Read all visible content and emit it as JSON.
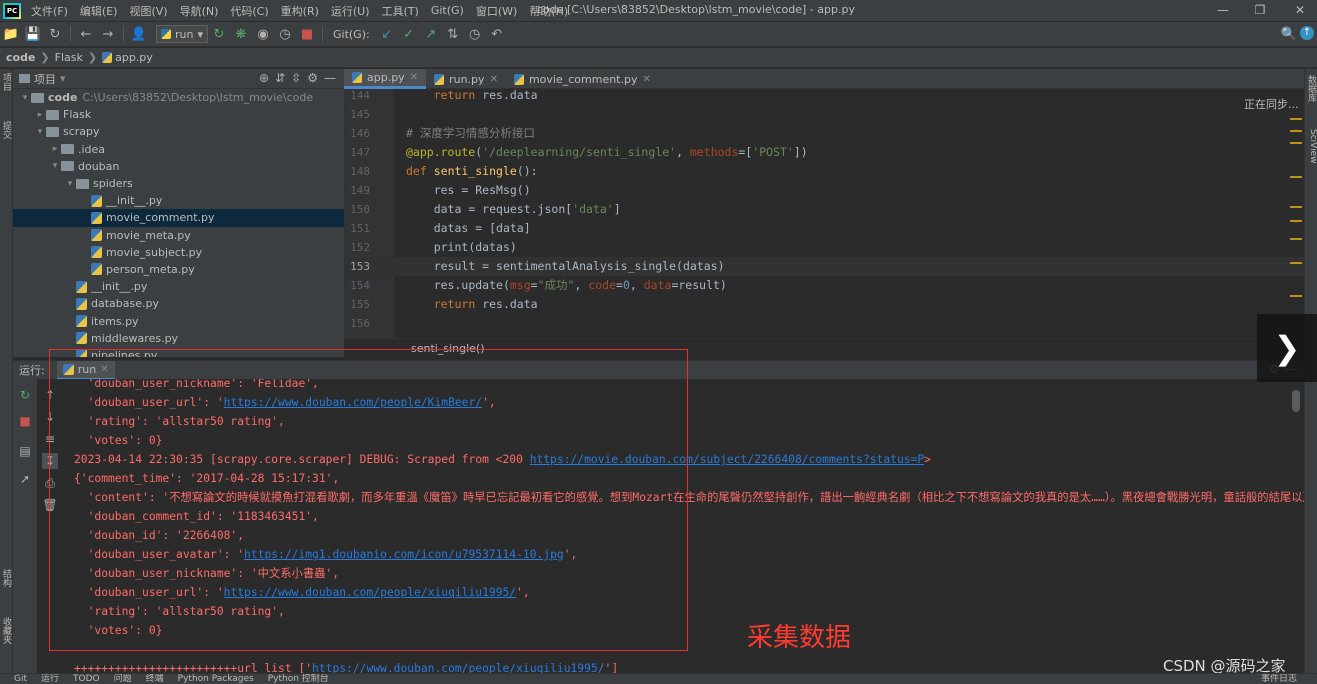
{
  "menubar": {
    "items": [
      "文件(F)",
      "编辑(E)",
      "视图(V)",
      "导航(N)",
      "代码(C)",
      "重构(R)",
      "运行(U)",
      "工具(T)",
      "Git(G)",
      "窗口(W)",
      "帮助(H)"
    ],
    "window_title": "code [C:\\Users\\83852\\Desktop\\lstm_movie\\code] - app.py",
    "minimize_icon": "minimize-icon",
    "maximize_icon": "maximize-icon",
    "close_icon": "close-icon"
  },
  "toolbar": {
    "run_config": "run",
    "git_label": "Git(G):"
  },
  "breadcrumb": [
    "code",
    "Flask",
    "app.py"
  ],
  "left_strip": {
    "top1": "项目",
    "top2": "提交",
    "bottom1": "结构",
    "bottom2": "收藏夹"
  },
  "project": {
    "header": "项目",
    "tree": [
      {
        "label": "code",
        "path": "C:\\Users\\83852\\Desktop\\lstm_movie\\code",
        "type": "folder",
        "depth": 0,
        "open": true,
        "bold": true
      },
      {
        "label": "Flask",
        "type": "folder",
        "depth": 1,
        "open": false
      },
      {
        "label": "scrapy",
        "type": "folder",
        "depth": 1,
        "open": true
      },
      {
        "label": ".idea",
        "type": "folder",
        "depth": 2,
        "open": false
      },
      {
        "label": "douban",
        "type": "folder",
        "depth": 2,
        "open": true
      },
      {
        "label": "spiders",
        "type": "folder",
        "depth": 3,
        "open": true
      },
      {
        "label": "__init__.py",
        "type": "py",
        "depth": 4
      },
      {
        "label": "movie_comment.py",
        "type": "py",
        "depth": 4,
        "selected": true
      },
      {
        "label": "movie_meta.py",
        "type": "py",
        "depth": 4
      },
      {
        "label": "movie_subject.py",
        "type": "py",
        "depth": 4
      },
      {
        "label": "person_meta.py",
        "type": "py",
        "depth": 4
      },
      {
        "label": "__init__.py",
        "type": "py",
        "depth": 3
      },
      {
        "label": "database.py",
        "type": "py",
        "depth": 3
      },
      {
        "label": "items.py",
        "type": "py",
        "depth": 3
      },
      {
        "label": "middlewares.py",
        "type": "py",
        "depth": 3
      },
      {
        "label": "pipelines.py",
        "type": "py",
        "depth": 3
      }
    ]
  },
  "editor": {
    "tabs": [
      {
        "label": "app.py",
        "active": true
      },
      {
        "label": "run.py",
        "active": false
      },
      {
        "label": "movie_comment.py",
        "active": false
      }
    ],
    "lines": [
      {
        "n": "144",
        "html": "    <span class='kw'>return</span> <span class='plain'>res.data</span>"
      },
      {
        "n": "145",
        "html": ""
      },
      {
        "n": "146",
        "html": "<span class='cmt'># 深度学习情感分析接口</span>"
      },
      {
        "n": "147",
        "html": "<span class='dec'>@app.route</span><span class='plain'>(</span><span class='str'>'/deeplearning/senti_single'</span><span class='plain'>, </span><span class='param'>methods</span><span class='plain'>=[</span><span class='str'>'POST'</span><span class='plain'>])</span>"
      },
      {
        "n": "148",
        "html": "<span class='kw'>def</span> <span class='fn'>senti_single</span><span class='plain'>():</span>"
      },
      {
        "n": "149",
        "html": "    <span class='plain'>res = ResMsg()</span>"
      },
      {
        "n": "150",
        "html": "    <span class='plain'>data = request.json[</span><span class='str'>'data'</span><span class='plain'>]</span>"
      },
      {
        "n": "151",
        "html": "    <span class='plain'>datas = [data]</span>"
      },
      {
        "n": "152",
        "html": "    <span class='plain'>print(datas)</span>"
      },
      {
        "n": "153",
        "html": "    <span class='plain'>result = sentimentalAnalysis_single(datas)</span>",
        "current": true
      },
      {
        "n": "154",
        "html": "    <span class='plain'>res.update(</span><span class='param'>msg</span><span class='plain'>=</span><span class='str'>\"成功\"</span><span class='plain'>, </span><span class='param'>code</span><span class='plain'>=</span><span class='num'>0</span><span class='plain'>, </span><span class='param'>data</span><span class='plain'>=result)</span>"
      },
      {
        "n": "155",
        "html": "    <span class='kw'>return</span> <span class='plain'>res.data</span>"
      },
      {
        "n": "156",
        "html": ""
      }
    ],
    "crumb": "senti_single()",
    "sync_status": "正在同步..."
  },
  "right_strip": {
    "label1": "数据库",
    "label2": "SciView"
  },
  "run": {
    "panel_label": "运行:",
    "tab_label": "run",
    "console": [
      {
        "text": "  'douban_user_nickname': 'Felidae',"
      },
      {
        "pre": "  'douban_user_url': '",
        "link": "https://www.douban.com/people/KimBeer/",
        "post": "',"
      },
      {
        "text": "  'rating': 'allstar50 rating',"
      },
      {
        "text": "  'votes': 0}"
      },
      {
        "pre": "2023-04-14 22:30:35 [scrapy.core.scraper] DEBUG: Scraped from <200 ",
        "link": "https://movie.douban.com/subject/2266408/comments?status=P",
        "post": ">"
      },
      {
        "text": "{'comment_time': '2017-04-28 15:17:31',"
      },
      {
        "text": "  'content': '不想寫論文的時候就摸魚打混看歌劇，而多年重溫《魔笛》時早已忘記最初看它的感覺。想到Mozart在生命的尾聲仍然堅持創作，譜出一齣經典名劇（相比之下不想寫論文的我真的是太……）。黑夜總會戰勝光明，童話般的結尾以及滋"
      },
      {
        "text": "  'douban_comment_id': '1183463451',"
      },
      {
        "text": "  'douban_id': '2266408',"
      },
      {
        "pre": "  'douban_user_avatar': '",
        "link": "https://img1.doubanio.com/icon/u79537114-10.jpg",
        "post": "',"
      },
      {
        "text": "  'douban_user_nickname': '中文系小書蟲',"
      },
      {
        "pre": "  'douban_user_url': '",
        "link": "https://www.douban.com/people/xiuqiliu1995/",
        "post": "',"
      },
      {
        "text": "  'rating': 'allstar50 rating',"
      },
      {
        "text": "  'votes': 0}"
      },
      {
        "text": ""
      },
      {
        "pre": "++++++++++++++++++++++++url_list ['",
        "link": "https://www.douban.com/people/xiuqiliu1995/",
        "post": "']"
      }
    ]
  },
  "caption": "采集数据",
  "watermark": "CSDN @源码之家",
  "statusbar": {
    "items": [
      "Git",
      "运行",
      "TODO",
      "问题",
      "终端",
      "Python Packages",
      "Python 控制台",
      "事件日志"
    ]
  }
}
